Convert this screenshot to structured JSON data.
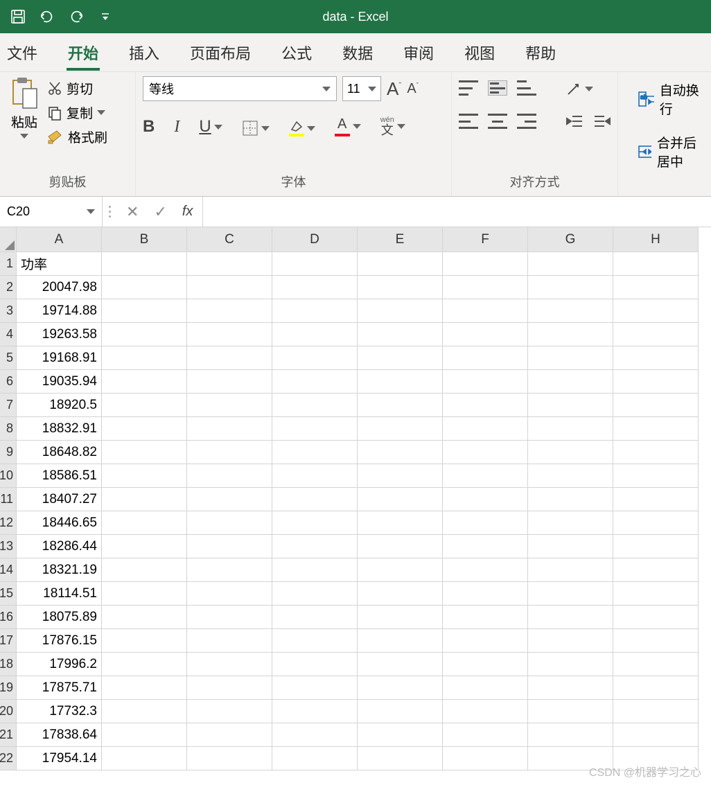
{
  "titlebar": {
    "title": "data  -  Excel"
  },
  "tabs": [
    "文件",
    "开始",
    "插入",
    "页面布局",
    "公式",
    "数据",
    "审阅",
    "视图",
    "帮助"
  ],
  "active_tab": 1,
  "clipboard": {
    "paste": "粘贴",
    "cut": "剪切",
    "copy": "复制",
    "format_painter": "格式刷",
    "group": "剪贴板"
  },
  "font": {
    "name": "等线",
    "size": "11",
    "bold": "B",
    "italic": "I",
    "underline": "U",
    "phonetic": "wén",
    "phonetic2": "文",
    "group": "字体"
  },
  "align": {
    "group": "对齐方式",
    "wrap": "自动换行",
    "merge": "合并后居中"
  },
  "namebox": "C20",
  "formula_label": "fx",
  "columns": [
    "A",
    "B",
    "C",
    "D",
    "E",
    "F",
    "G",
    "H"
  ],
  "spreadsheet": {
    "header": "功率",
    "values": [
      "20047.98",
      "19714.88",
      "19263.58",
      "19168.91",
      "19035.94",
      "18920.5",
      "18832.91",
      "18648.82",
      "18586.51",
      "18407.27",
      "18446.65",
      "18286.44",
      "18321.19",
      "18114.51",
      "18075.89",
      "17876.15",
      "17996.2",
      "17875.71",
      "17732.3",
      "17838.64",
      "17954.14"
    ]
  },
  "watermark": "CSDN @机器学习之心"
}
